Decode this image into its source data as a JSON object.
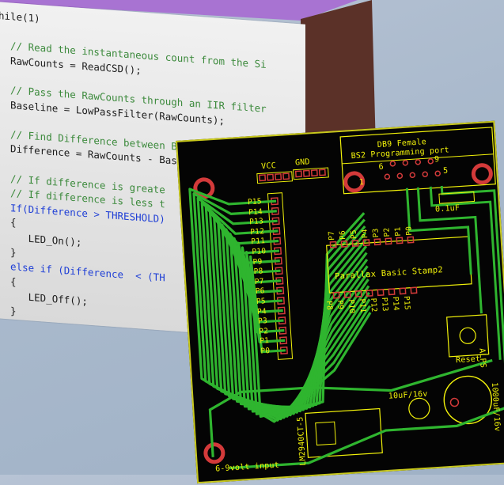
{
  "code": {
    "lines": [
      {
        "text": "hile(1)",
        "kind": "plain"
      },
      {
        "text": "",
        "kind": "plain"
      },
      {
        "text": "  // Read the instantaneous count from the Si",
        "kind": "comment"
      },
      {
        "text": "  RawCounts = ReadCSD();",
        "kind": "plain"
      },
      {
        "text": "",
        "kind": "plain"
      },
      {
        "text": "  // Pass the RawCounts through an IIR filter",
        "kind": "comment"
      },
      {
        "text": "  Baseline = LowPassFilter(RawCounts);",
        "kind": "plain"
      },
      {
        "text": "",
        "kind": "plain"
      },
      {
        "text": "  // Find Difference between Baseline and Inst",
        "kind": "comment"
      },
      {
        "text": "  Difference = RawCounts - Baseline;",
        "kind": "plain"
      },
      {
        "text": "",
        "kind": "plain"
      },
      {
        "text": "  // If difference is greate",
        "kind": "comment"
      },
      {
        "text": "  // If difference is less t",
        "kind": "comment"
      },
      {
        "text": "  If(Difference > THRESHOLD)",
        "kind": "keyword"
      },
      {
        "text": "  {",
        "kind": "plain"
      },
      {
        "text": "     LED_On();",
        "kind": "plain"
      },
      {
        "text": "  }",
        "kind": "plain"
      },
      {
        "text": "  else if (Difference  < (TH",
        "kind": "keyword"
      },
      {
        "text": "  {",
        "kind": "plain"
      },
      {
        "text": "     LED_Off();",
        "kind": "plain"
      },
      {
        "text": "  }",
        "kind": "plain"
      }
    ]
  },
  "pcb": {
    "labels": {
      "vcc": "VCC",
      "gnd": "GND",
      "db9_line1": "DB9 Female",
      "db9_line2": "BS2 Programming port",
      "pin6": "6",
      "pin9": "9",
      "pin1": "1",
      "pin5": "5",
      "cap_small": "0.1uF",
      "chip": "Parallax Basic Stamp2",
      "reset": "Reset",
      "switch_part": "ALPS",
      "cap_mid": "10uF/16v",
      "cap_big": "1000uF/16v",
      "regulator": "LM2940CT-5",
      "power_input": "6-9volt input"
    },
    "left_pins": [
      "P15",
      "P14",
      "P13",
      "P12",
      "P11",
      "P10",
      "P9",
      "P8",
      "P7",
      "P6",
      "P5",
      "P4",
      "P3",
      "P2",
      "P1",
      "P0"
    ],
    "chip_top_pins": [
      "P7",
      "P6",
      "P5",
      "P4",
      "P3",
      "P2",
      "P1",
      "P0"
    ],
    "chip_bottom_pins": [
      "P8",
      "P9",
      "P10",
      "P11",
      "P12",
      "P13",
      "P14",
      "P15"
    ],
    "colors": {
      "board": "#040404",
      "trace": "#2fb52f",
      "silkscreen": "#f2f20a",
      "pad": "#d33a3a"
    }
  }
}
